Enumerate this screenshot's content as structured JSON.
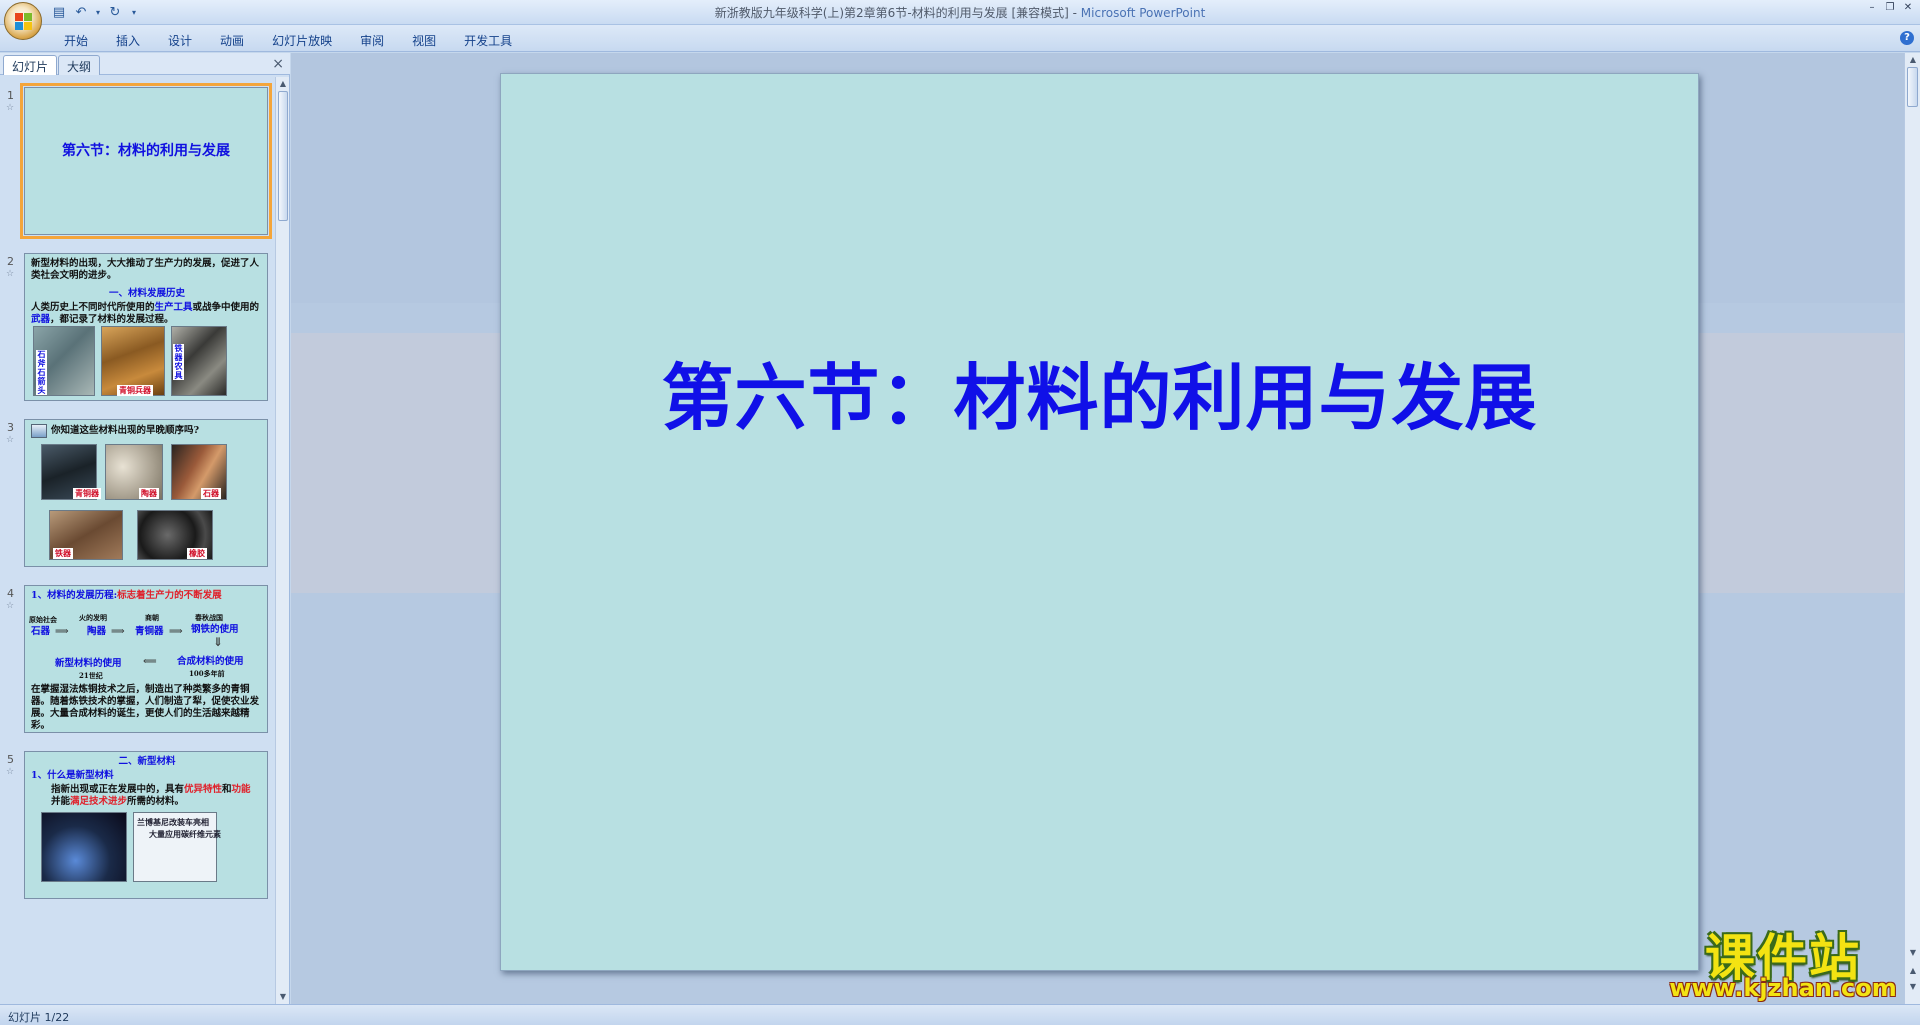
{
  "titlebar": {
    "title": "新浙教版九年级科学(上)第2章第6节-材料的利用与发展 [兼容模式] - ",
    "app_name": "Microsoft PowerPoint",
    "qat_save_icon": "save-icon",
    "qat_undo_icon": "undo-icon",
    "qat_redo_icon": "redo-icon"
  },
  "ribbon": {
    "tabs": [
      "开始",
      "插入",
      "设计",
      "动画",
      "幻灯片放映",
      "审阅",
      "视图",
      "开发工具"
    ],
    "help": "?"
  },
  "pane": {
    "tab_slides": "幻灯片",
    "tab_outline": "大纲",
    "close": "×"
  },
  "thumbnails": [
    {
      "num": "1",
      "title": "第六节：材料的利用与发展"
    },
    {
      "num": "2",
      "intro": "新型材料的出现，大大推动了生产力的发展，促进了人类社会文明的进步。",
      "heading": "一、材料发展历史",
      "body_a": "人类历史上不同时代所使用的",
      "body_b": "生产工具",
      "body_c": "或战争中使用的",
      "body_d": "武器",
      "body_e": "，都记录了材料的发展过程。",
      "label_stone": "石斧石箭头",
      "label_bronze": "青铜兵器",
      "label_iron": "铁器农具"
    },
    {
      "num": "3",
      "question": "你知道这些材料出现的早晚顺序吗?",
      "labels": [
        "青铜器",
        "陶器",
        "石器",
        "铁器",
        "橡胶"
      ]
    },
    {
      "num": "4",
      "heading_a": "1、材料的发展历程:",
      "heading_b": "标志着生产力的不断发展",
      "era1": "原始社会",
      "mat1": "石器",
      "era2": "火的发明",
      "mat2": "陶器",
      "era3": "商朝",
      "mat3": "青铜器",
      "era4": "春秋战国",
      "mat4": "钢铁的使用",
      "mat5": "合成材料的使用",
      "era5": "100多年前",
      "mat6": "新型材料的使用",
      "era6": "21世纪",
      "body": "在掌握湿法炼铜技术之后，制造出了种类繁多的青铜器。随着炼铁技术的掌握，人们制造了犁，促使农业发展。大量合成材料的诞生，更使人们的生活越来越精彩。"
    },
    {
      "num": "5",
      "heading": "二、新型材料",
      "sub": "1、什么是新型材料",
      "body_a": "指新出现或正在发展中的，具有",
      "body_b": "优异特性",
      "body_c": "和",
      "body_d": "功能",
      "body_e": "并能",
      "body_f": "满足技术进步",
      "body_g": "所需的材料。",
      "caption_a": "兰博基尼改装车亮相",
      "caption_b": "大量应用碳纤维元素"
    }
  ],
  "slide": {
    "title": "第六节：材料的利用与发展",
    "background": "#b8e0e2",
    "title_color": "#1010e8"
  },
  "status": {
    "text": "幻灯片 1/22"
  },
  "watermark": {
    "big": "课件站",
    "url": "www.kjzhan.com"
  }
}
